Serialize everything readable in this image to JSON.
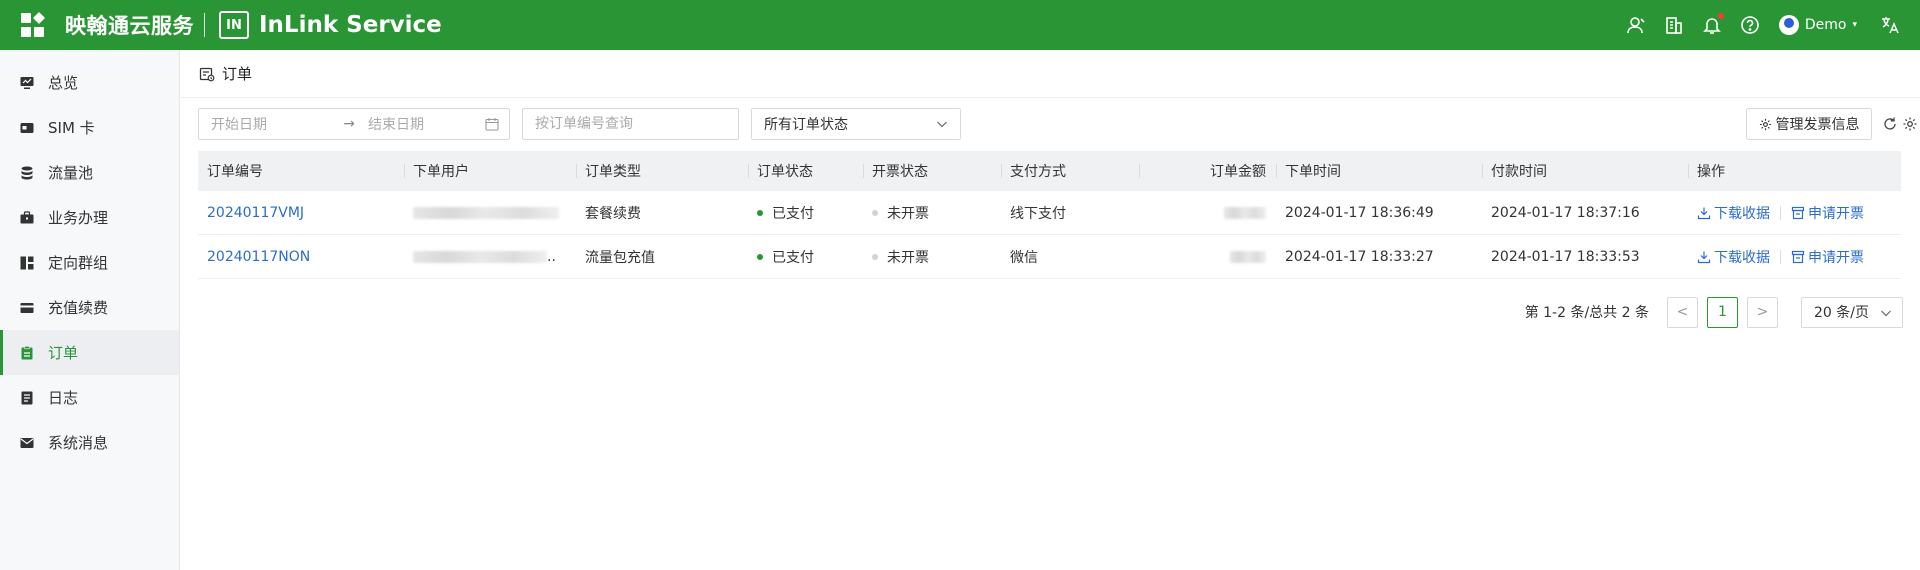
{
  "header": {
    "brand_cn": "映翰通云服务",
    "logo_text": "IN",
    "brand_en": "InLink Service",
    "user_name": "Demo",
    "caret": "▾"
  },
  "sidebar": {
    "items": [
      {
        "label": "总览",
        "icon": "monitor-icon"
      },
      {
        "label": "SIM 卡",
        "icon": "sim-card-icon"
      },
      {
        "label": "流量池",
        "icon": "database-icon"
      },
      {
        "label": "业务办理",
        "icon": "briefcase-icon"
      },
      {
        "label": "定向群组",
        "icon": "group-icon"
      },
      {
        "label": "充值续费",
        "icon": "card-icon"
      },
      {
        "label": "订单",
        "icon": "order-icon",
        "active": true
      },
      {
        "label": "日志",
        "icon": "log-icon"
      },
      {
        "label": "系统消息",
        "icon": "mail-icon"
      }
    ]
  },
  "page": {
    "title": "订单"
  },
  "filters": {
    "start_date_placeholder": "开始日期",
    "range_arrow": "→",
    "end_date_placeholder": "结束日期",
    "order_search_placeholder": "按订单编号查询",
    "status_value": "所有订单状态",
    "manage_invoice_label": "管理发票信息"
  },
  "table": {
    "columns": [
      "订单编号",
      "下单用户",
      "订单类型",
      "订单状态",
      "开票状态",
      "支付方式",
      "订单金额",
      "下单时间",
      "付款时间",
      "操作"
    ],
    "rows": [
      {
        "order_no": "20240117VMJ",
        "user": "",
        "type": "套餐续费",
        "status": "已支付",
        "invoice_status": "未开票",
        "payment": "线下支付",
        "amount": "",
        "order_time": "2024-01-17 18:36:49",
        "pay_time": "2024-01-17 18:37:16",
        "action_download": "下载收据",
        "action_invoice": "申请开票"
      },
      {
        "order_no": "20240117NON",
        "user": "..",
        "type": "流量包充值",
        "status": "已支付",
        "invoice_status": "未开票",
        "payment": "微信",
        "amount": "",
        "order_time": "2024-01-17 18:33:27",
        "pay_time": "2024-01-17 18:33:53",
        "action_download": "下载收据",
        "action_invoice": "申请开票"
      }
    ]
  },
  "pagination": {
    "total_text": "第 1-2 条/总共 2 条",
    "prev": "<",
    "current_page": "1",
    "next": ">",
    "page_size": "20 条/页"
  },
  "colors": {
    "brand_green": "#2a9535",
    "link_blue": "#2b6cd0",
    "notification_red": "#ff3b30"
  }
}
